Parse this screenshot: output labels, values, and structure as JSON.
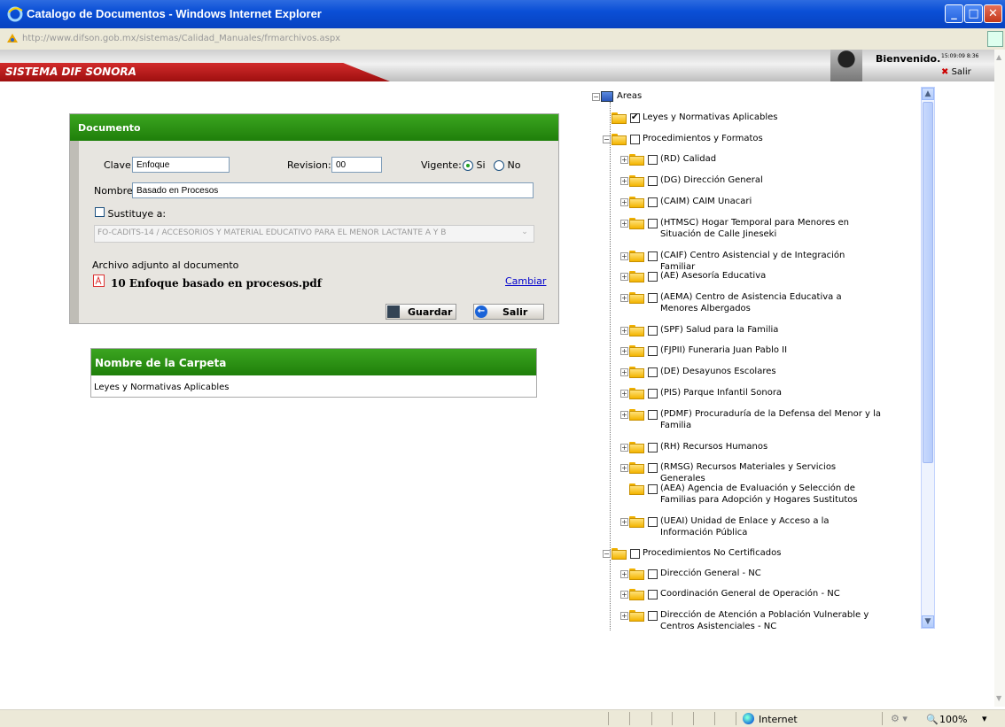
{
  "window": {
    "title": "Catalogo de Documentos - Windows Internet Explorer",
    "url": "http://www.difson.gob.mx/sistemas/Calidad_Manuales/frmarchivos.aspx",
    "url_domain": "difson.gob.mx"
  },
  "header": {
    "system_name": "SISTEMA DIF SONORA",
    "welcome": "Bienvenido.",
    "small_info": "15:09:09 8:36",
    "logout": "Salir"
  },
  "document": {
    "title": "Documento",
    "clave_label": "Clave:",
    "clave_value": "Enfoque",
    "revision_label": "Revision:",
    "revision_value": "00",
    "vigente_label": "Vigente:",
    "vigente_si": "Si",
    "vigente_no": "No",
    "nombre_label": "Nombre:",
    "nombre_value": "Basado en Procesos",
    "sustituye_label": "Sustituye a:",
    "sustituye_select": "FO-CADITS-14 / ACCESORIOS Y MATERIAL EDUCATIVO PARA EL MENOR LACTANTE A Y B",
    "attachment_label": "Archivo adjunto al documento",
    "attachment_file": "10 Enfoque basado en procesos.pdf",
    "change_link": "Cambiar",
    "save_button": "Guardar",
    "exit_button": "Salir"
  },
  "folder": {
    "title": "Nombre de la Carpeta",
    "value": "Leyes y Normativas Aplicables"
  },
  "tree": {
    "root": "Areas",
    "nodes": [
      {
        "label": "Leyes y Normativas Aplicables",
        "checked": true
      },
      {
        "label": "Procedimientos y Formatos",
        "checked": false
      },
      {
        "label": "(RD) Calidad",
        "checked": false
      },
      {
        "label": "(DG) Dirección General",
        "checked": false
      },
      {
        "label": "(CAIM) CAIM Unacari",
        "checked": false
      },
      {
        "label": "(HTMSC) Hogar Temporal para Menores en Situación de Calle Jineseki",
        "checked": false
      },
      {
        "label": "(CAIF) Centro Asistencial y de Integración Familiar",
        "checked": false
      },
      {
        "label": "(AE) Asesoría Educativa",
        "checked": false
      },
      {
        "label": "(AEMA) Centro de Asistencia Educativa a Menores Albergados",
        "checked": false
      },
      {
        "label": "(SPF) Salud para la Familia",
        "checked": false
      },
      {
        "label": "(FJPII) Funeraria Juan Pablo II",
        "checked": false
      },
      {
        "label": "(DE) Desayunos Escolares",
        "checked": false
      },
      {
        "label": "(PIS) Parque Infantil Sonora",
        "checked": false
      },
      {
        "label": "(PDMF) Procuraduría de la Defensa del Menor y la Familia",
        "checked": false
      },
      {
        "label": "(RH) Recursos Humanos",
        "checked": false
      },
      {
        "label": "(RMSG) Recursos Materiales y Servicios Generales",
        "checked": false
      },
      {
        "label": "(AEA) Agencia de Evaluación y Selección de Familias para Adopción y Hogares Sustitutos",
        "checked": false
      },
      {
        "label": "(UEAI) Unidad de Enlace y Acceso a la Información Pública",
        "checked": false
      },
      {
        "label": "Procedimientos No Certificados",
        "checked": false
      },
      {
        "label": "Dirección General - NC",
        "checked": false
      },
      {
        "label": "Coordinación General de Operación - NC",
        "checked": false
      },
      {
        "label": "Dirección de Atención a Población Vulnerable y Centros Asistenciales - NC",
        "checked": false
      }
    ]
  },
  "statusbar": {
    "zone": "Internet",
    "zoom": "100%"
  }
}
